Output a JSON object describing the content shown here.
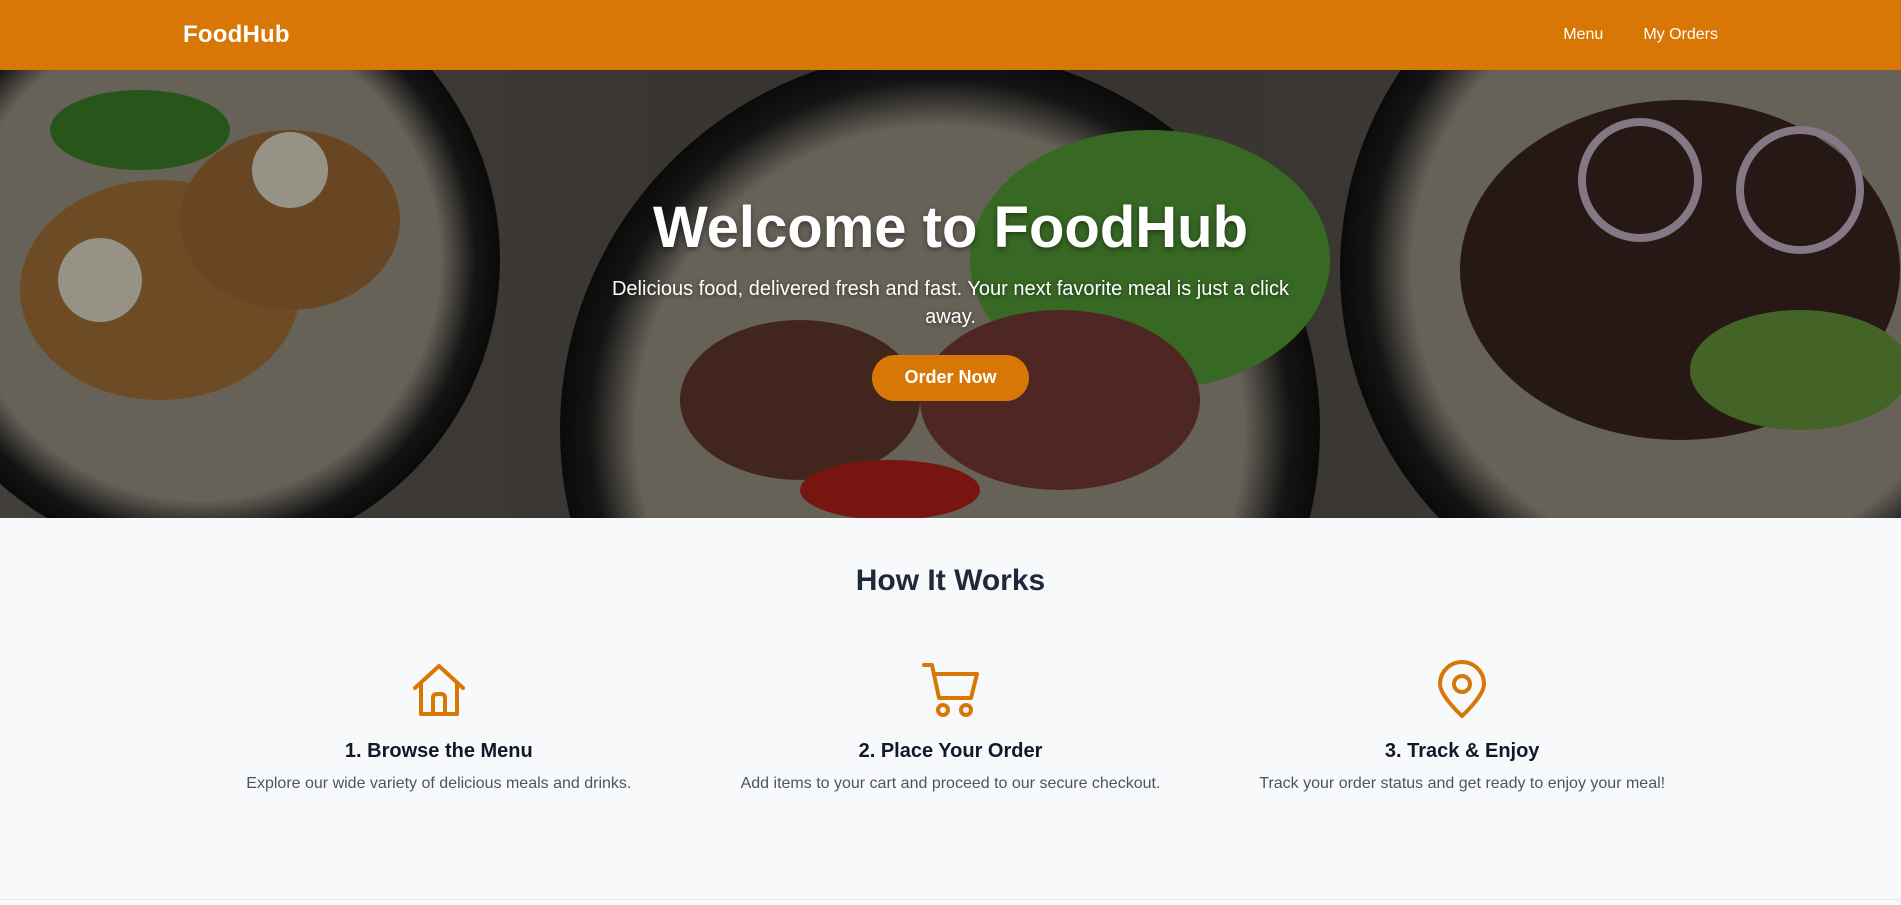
{
  "colors": {
    "accent": "#d97706",
    "heading": "#1e293b",
    "body_text": "#4b5563",
    "page_bg": "#f8f9fb"
  },
  "header": {
    "brand": "FoodHub",
    "nav": [
      {
        "label": "Menu"
      },
      {
        "label": "My Orders"
      }
    ]
  },
  "hero": {
    "title": "Welcome to FoodHub",
    "subtitle": "Delicious food, delivered fresh and fast. Your next favorite meal is just a click away.",
    "cta_label": "Order Now"
  },
  "how_it_works": {
    "title": "How It Works",
    "steps": [
      {
        "icon": "home-icon",
        "title": "1. Browse the Menu",
        "description": "Explore our wide variety of delicious meals and drinks."
      },
      {
        "icon": "shopping-cart-icon",
        "title": "2. Place Your Order",
        "description": "Add items to your cart and proceed to our secure checkout."
      },
      {
        "icon": "map-pin-icon",
        "title": "3. Track & Enjoy",
        "description": "Track your order status and get ready to enjoy your meal!"
      }
    ]
  }
}
